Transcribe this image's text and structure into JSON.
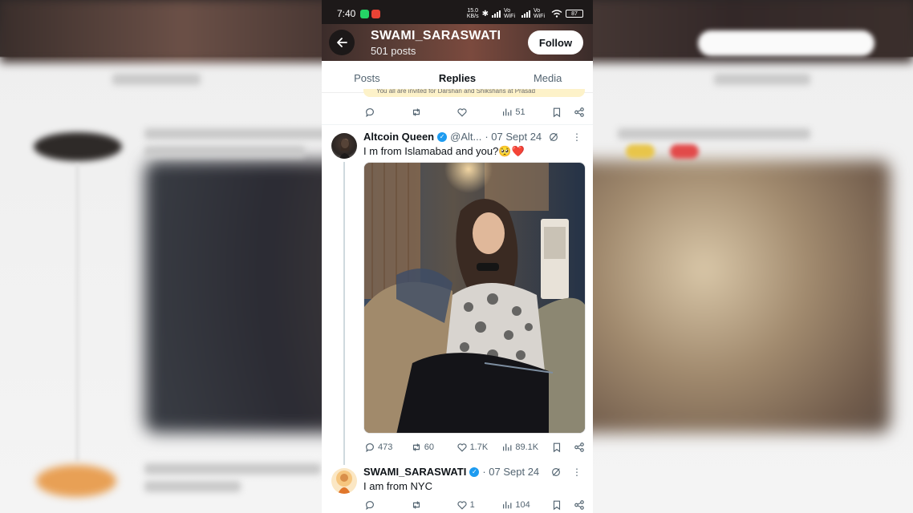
{
  "status_bar": {
    "time": "7:40",
    "net_speed_value": "15.0",
    "net_speed_unit": "KB/s",
    "vo_wifi_1": "Vo WiFi",
    "vo_wifi_2": "Vo WiFi",
    "battery": "87"
  },
  "header": {
    "title": "SWAMI_SARASWATI",
    "posts": "501 posts",
    "follow_label": "Follow"
  },
  "tabs": [
    {
      "label": "Posts",
      "active": false
    },
    {
      "label": "Replies",
      "active": true
    },
    {
      "label": "Media",
      "active": false
    }
  ],
  "prev_post": {
    "quote_text": "You all are invited for Darshan and Shikshans at Prasad",
    "replies": "",
    "reposts": "",
    "likes": "",
    "views": "51"
  },
  "tweets": [
    {
      "author": "Altcoin Queen",
      "handle": "@Alt...",
      "date": "· 07 Sept 24",
      "text": "I m from Islamabad and you?🥺❤️",
      "replies": "473",
      "reposts": "60",
      "likes": "1.7K",
      "views": "89.1K"
    },
    {
      "author": "SWAMI_SARASWATI",
      "handle": "",
      "date": "· 07 Sept 24",
      "text": "I am from NYC",
      "replies": "",
      "reposts": "",
      "likes": "1",
      "views": "104"
    }
  ],
  "colors": {
    "accent": "#1d9bf0",
    "text_primary": "#0f1419",
    "text_secondary": "#536471"
  }
}
